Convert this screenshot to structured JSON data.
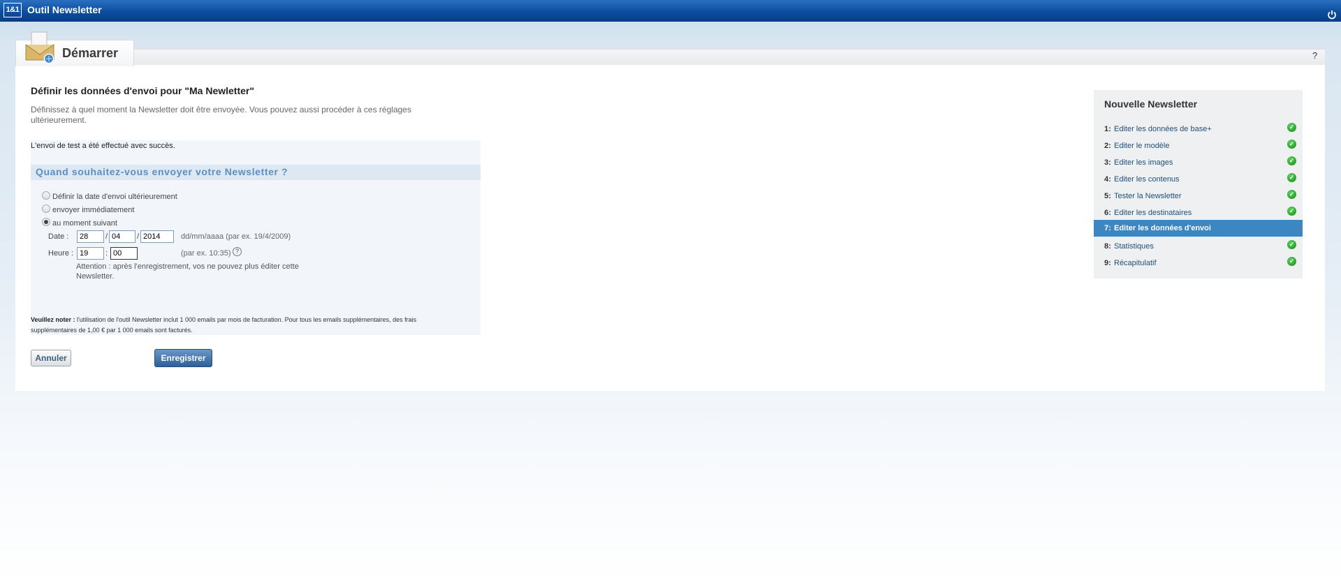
{
  "app": {
    "logo": "1&1",
    "title": "Outil Newsletter"
  },
  "tab": {
    "label": "Démarrer",
    "help": "?"
  },
  "header": {
    "title": "Définir les données d'envoi pour \"Ma Newletter\"",
    "description": "Définissez à quel moment la Newsletter doit être envoyée. Vous pouvez aussi procéder à ces réglages ultérieurement."
  },
  "form": {
    "success_message": "L'envoi de test a été effectué avec succès.",
    "question": "Quand souhaitez-vous envoyer votre Newsletter ?",
    "options": [
      {
        "label": "Définir la date d'envoi ultérieurement",
        "selected": false
      },
      {
        "label": "envoyer immédiatement",
        "selected": false
      },
      {
        "label": "au moment suivant",
        "selected": true
      }
    ],
    "date": {
      "label": "Date :",
      "day": "28",
      "month": "04",
      "year": "2014",
      "separator": "/",
      "hint": "dd/mm/aaaa (par ex. 19/4/2009)"
    },
    "time": {
      "label": "Heure :",
      "hours": "19",
      "minutes": "00",
      "separator": ":",
      "hint": "(par ex. 10:35)",
      "help": "?"
    },
    "warning": "Attention : après l'enregistrement, vos ne pouvez plus éditer cette Newsletter.",
    "note_label": "Veuillez noter :",
    "note_text": " l'utilisation de l'outil Newsletter inclut 1 000 emails par mois de facturation. Pour tous les emails supplémentaires, des frais supplémentaires de 1,00 € par 1 000 emails sont facturés."
  },
  "buttons": {
    "cancel": "Annuler",
    "save": "Enregistrer"
  },
  "steps": {
    "title": "Nouvelle Newsletter",
    "items": [
      {
        "num": "1:",
        "label": "Editer les données de base+",
        "done": true,
        "active": false
      },
      {
        "num": "2:",
        "label": "Editer le modèle",
        "done": true,
        "active": false
      },
      {
        "num": "3:",
        "label": "Editer les images",
        "done": true,
        "active": false
      },
      {
        "num": "4:",
        "label": "Editer les contenus",
        "done": true,
        "active": false
      },
      {
        "num": "5:",
        "label": "Tester la Newsletter",
        "done": true,
        "active": false
      },
      {
        "num": "6:",
        "label": "Editer les destinataires",
        "done": true,
        "active": false
      },
      {
        "num": "7:",
        "label": "Editer les données d'envoi",
        "done": false,
        "active": true
      },
      {
        "num": "8:",
        "label": "Statistiques",
        "done": true,
        "active": false
      },
      {
        "num": "9:",
        "label": "Récapitulatif",
        "done": true,
        "active": false
      }
    ]
  },
  "colors": {
    "topbar": "#0d4ea0",
    "accent": "#3c86c1",
    "question": "#5b8fc4",
    "check": "#2aa02a"
  },
  "icons": {
    "power": "power-icon",
    "tab": "newsletter-envelope-icon",
    "check": "check-icon"
  }
}
